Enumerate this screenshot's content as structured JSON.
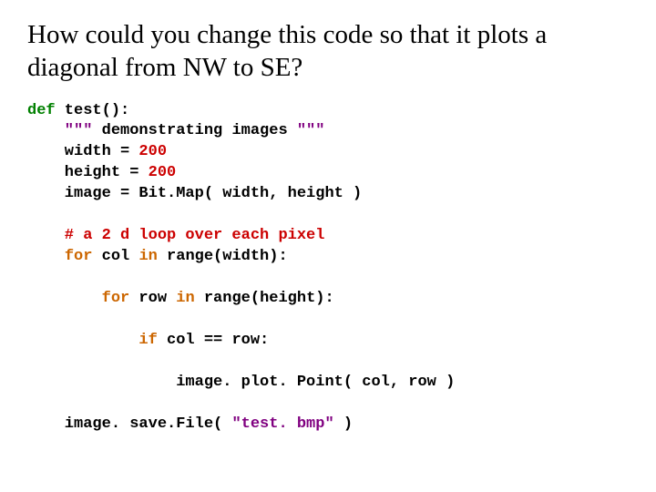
{
  "title": "How could you change this code so that it plots a diagonal from NW to SE?",
  "code": {
    "def": "def",
    "test_sig": " test():",
    "doc_open": "    \"\"\"",
    "doc_body": " demonstrating images ",
    "doc_close": "\"\"\"",
    "w_lhs": "    width = ",
    "w_val": "200",
    "h_lhs": "    height = ",
    "h_val": "200",
    "img_line": "    image = Bit.Map( width, height )",
    "comment": "    # a 2 d loop over each pixel",
    "for1a": "    ",
    "for1_for": "for",
    "for1b": " col ",
    "for1_in": "in",
    "for1c": " range(width):",
    "for2a": "        ",
    "for2_for": "for",
    "for2b": " row ",
    "for2_in": "in",
    "for2c": " range(height):",
    "if_a": "            ",
    "if_kw": "if",
    "if_b": " col == row:",
    "plot": "                image. plot. Point( col, row )",
    "save_a": "    image. save.File( ",
    "save_str": "\"test. bmp\"",
    "save_b": " )"
  }
}
